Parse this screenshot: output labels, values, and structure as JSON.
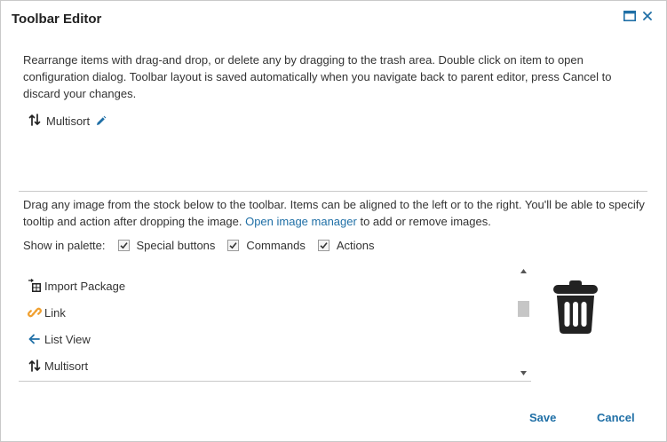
{
  "dialog": {
    "title": "Toolbar Editor",
    "header_icons": [
      "maximize-icon",
      "close-icon"
    ]
  },
  "description": "Rearrange items with drag-and drop, or delete any by dragging to the trash area. Double click on item to open configuration dialog. Toolbar layout is saved automatically when you navigate back to parent editor, press Cancel to discard your changes.",
  "toolbar": {
    "items": [
      {
        "label": "Multisort",
        "icon": "sort-arrows-icon",
        "edit_icon": "pencil-icon"
      }
    ]
  },
  "stock": {
    "description_prefix": "Drag any image from the stock below to the toolbar. Items can be aligned to the left or to the right. You'll be able to specify tooltip and action after dropping the image.",
    "link_label": "Open image manager",
    "description_suffix": "to add or remove images.",
    "palette_label": "Show in palette:",
    "filters": [
      {
        "label": "Special buttons",
        "checked": true
      },
      {
        "label": "Commands",
        "checked": true
      },
      {
        "label": "Actions",
        "checked": true
      }
    ],
    "items": [
      {
        "label": "Import Package",
        "icon": "import-package-icon"
      },
      {
        "label": "Link",
        "icon": "link-icon"
      },
      {
        "label": "List View",
        "icon": "arrow-left-icon"
      },
      {
        "label": "Multisort",
        "icon": "sort-arrows-icon"
      }
    ],
    "trash_icon": "trash-icon"
  },
  "footer": {
    "save_label": "Save",
    "cancel_label": "Cancel"
  },
  "colors": {
    "accent": "#1f6fa6",
    "link_icon": "#f0a030",
    "border": "#c9c9c9"
  }
}
